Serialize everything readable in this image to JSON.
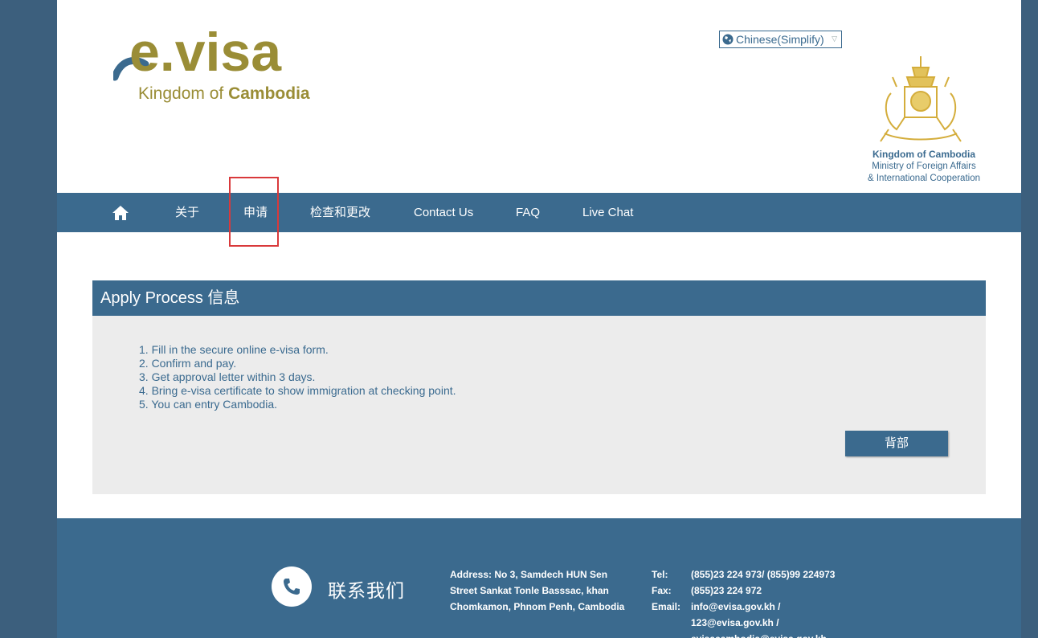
{
  "header": {
    "logo_main": "e.visa",
    "logo_sub_prefix": "Kingdom of ",
    "logo_sub_bold": "Cambodia",
    "language": "Chinese(Simplify)",
    "ministry_line1": "Kingdom of Cambodia",
    "ministry_line2": "Ministry of Foreign Affairs",
    "ministry_line3": "& International Cooperation"
  },
  "nav": {
    "items": [
      {
        "label": "关于"
      },
      {
        "label": "申请"
      },
      {
        "label": "检查和更改"
      },
      {
        "label": "Contact Us"
      },
      {
        "label": "FAQ"
      },
      {
        "label": "Live Chat"
      }
    ]
  },
  "panel": {
    "title": "Apply Process 信息",
    "steps": [
      "1. Fill in the secure online e-visa form.",
      "2. Confirm and pay.",
      "3. Get approval letter within 3 days.",
      "4. Bring e-visa certificate to show immigration at checking point.",
      "5. You can entry Cambodia."
    ],
    "back_label": "背部"
  },
  "footer": {
    "contact_title": "联系我们",
    "address_lines": [
      "Address: No 3, Samdech HUN Sen",
      "Street Sankat Tonle Basssac, khan",
      "Chomkamon, Phnom Penh, Cambodia"
    ],
    "tel_label": "Tel:",
    "tel_value": "(855)23 224 973/ (855)99 224973",
    "fax_label": "Fax:",
    "fax_value": "(855)23 224 972",
    "email_label": "Email:",
    "email_value_1": "info@evisa.gov.kh /",
    "email_value_2": "123@evisa.gov.kh /",
    "email_value_3": "evisacambodia@evisa.gov.kh"
  },
  "colors": {
    "brand_blue": "#3b6a8e",
    "olive": "#9a8d36",
    "highlight_red": "#d9393b",
    "panel_gray": "#ececec"
  }
}
